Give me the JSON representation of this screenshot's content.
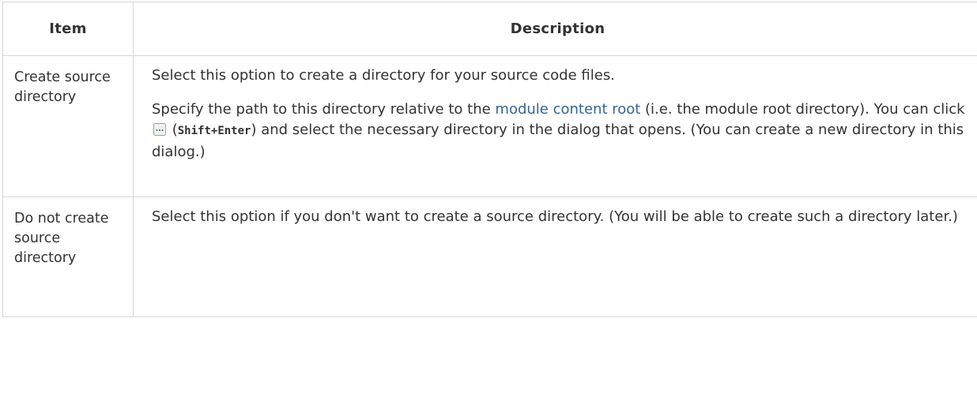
{
  "table": {
    "headers": {
      "item": "Item",
      "description": "Description"
    },
    "rows": [
      {
        "item": "Create source directory",
        "para1": "Select this option to create a directory for your source code files.",
        "para2_before_link": "Specify the path to this directory relative to the ",
        "para2_link": "module content root",
        "para2_after_link": " (i.e. the module root directory). You can click ",
        "para2_open_paren": " (",
        "para2_shortcut": "Shift+Enter",
        "para2_after_shortcut": ") and select the necessary directory in the dialog that opens. (You can create a new directory in this dialog.)"
      },
      {
        "item": "Do not create source directory",
        "para1": "Select this option if you don't want to create a source directory. (You will be able to create such a directory later.)"
      }
    ]
  },
  "icons": {
    "browse": "browse-ellipsis-icon"
  }
}
